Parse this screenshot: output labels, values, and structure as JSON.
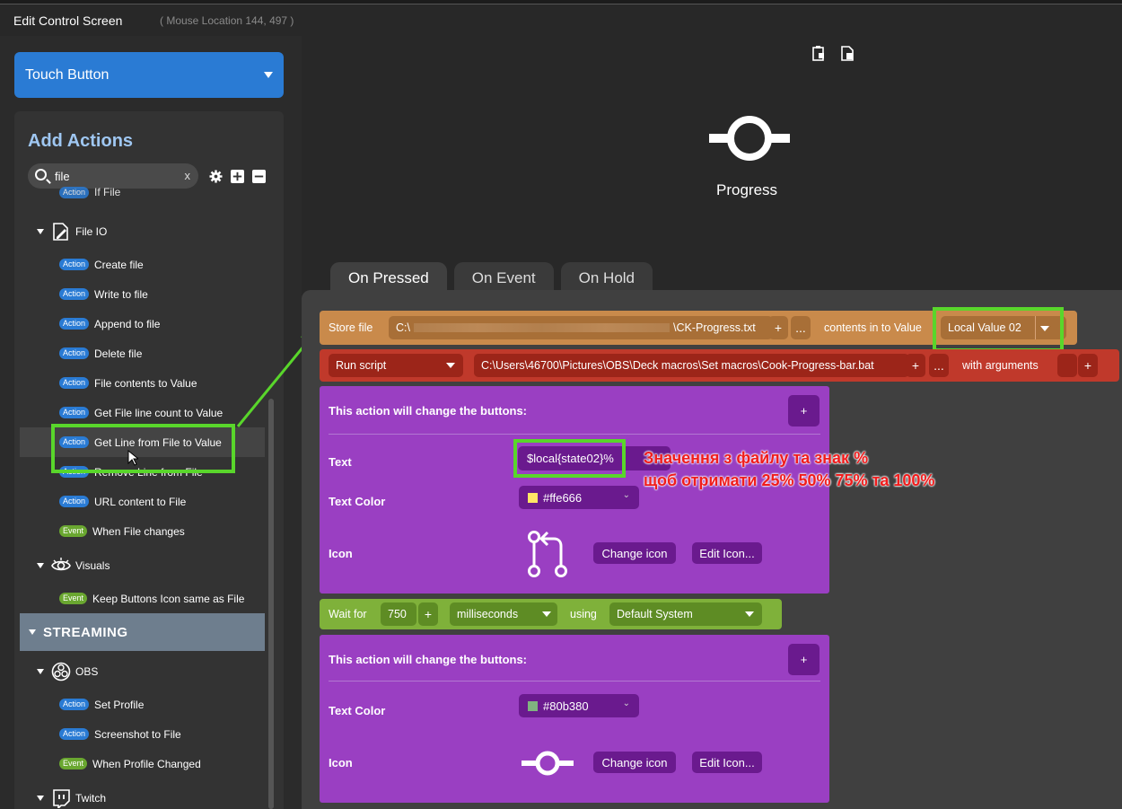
{
  "window": {
    "title": "Edit Control Screen",
    "mouse_location": "( Mouse Location 144, 497 )"
  },
  "control_type": {
    "selected": "Touch Button"
  },
  "add_actions": {
    "title": "Add Actions",
    "search_value": "file",
    "clear_label": "x",
    "items": [
      {
        "type": "row",
        "badge": "Action",
        "label": "If File",
        "kind": "action"
      },
      {
        "type": "group",
        "label": "File IO",
        "icon": "file-edit-icon"
      },
      {
        "type": "row",
        "badge": "Action",
        "label": "Create file",
        "kind": "action"
      },
      {
        "type": "row",
        "badge": "Action",
        "label": "Write to file",
        "kind": "action"
      },
      {
        "type": "row",
        "badge": "Action",
        "label": "Append to file",
        "kind": "action"
      },
      {
        "type": "row",
        "badge": "Action",
        "label": "Delete file",
        "kind": "action"
      },
      {
        "type": "row",
        "badge": "Action",
        "label": "File contents to Value",
        "kind": "action"
      },
      {
        "type": "row",
        "badge": "Action",
        "label": "Get File line count to Value",
        "kind": "action"
      },
      {
        "type": "row",
        "badge": "Action",
        "label": "Get Line from File to Value",
        "kind": "action",
        "highlighted": true
      },
      {
        "type": "row",
        "badge": "Action",
        "label": "Remove Line from File",
        "kind": "action"
      },
      {
        "type": "row",
        "badge": "Action",
        "label": "URL content to File",
        "kind": "action"
      },
      {
        "type": "row",
        "badge": "Event",
        "label": "When File changes",
        "kind": "event"
      },
      {
        "type": "group",
        "label": "Visuals",
        "icon": "eye-icon"
      },
      {
        "type": "row",
        "badge": "Event",
        "label": "Keep Buttons Icon same as File",
        "kind": "event"
      },
      {
        "type": "section",
        "label": "STREAMING"
      },
      {
        "type": "group",
        "label": "OBS",
        "icon": "obs-icon"
      },
      {
        "type": "row",
        "badge": "Action",
        "label": "Set Profile",
        "kind": "action"
      },
      {
        "type": "row",
        "badge": "Action",
        "label": "Screenshot to File",
        "kind": "action"
      },
      {
        "type": "row",
        "badge": "Event",
        "label": "When Profile Changed",
        "kind": "event"
      },
      {
        "type": "group",
        "label": "Twitch",
        "icon": "twitch-icon"
      }
    ]
  },
  "preview": {
    "label": "Progress"
  },
  "tabs": [
    "On Pressed",
    "On Event",
    "On Hold"
  ],
  "actions": {
    "store_file": {
      "label": "Store file",
      "path_start": "C:\\",
      "path_end": "\\CK-Progress.txt",
      "plus": "+",
      "more": "...",
      "middle": "contents in to Value",
      "value": "Local Value 02"
    },
    "run_script": {
      "mode": "Run script",
      "path": "C:\\Users\\46700\\Pictures\\OBS\\Deck macros\\Set macros\\Cook-Progress-bar.bat",
      "plus": "+",
      "more": "...",
      "with_args": "with arguments",
      "plus2": "+"
    },
    "change1": {
      "title": "This action will change the buttons:",
      "plus": "+",
      "text_label": "Text",
      "text_value": "$local{state02}%",
      "color_label": "Text Color",
      "color_value": "#ffe666",
      "color_swatch": "#ffe666",
      "icon_label": "Icon",
      "change_icon": "Change icon",
      "edit_icon": "Edit Icon..."
    },
    "wait": {
      "label": "Wait for",
      "value": "750",
      "plus": "+",
      "unit": "milliseconds",
      "using": "using",
      "system": "Default System"
    },
    "change2": {
      "title": "This action will change the buttons:",
      "plus": "+",
      "color_label": "Text Color",
      "color_value": "#80b380",
      "color_swatch": "#80b380",
      "icon_label": "Icon",
      "change_icon": "Change icon",
      "edit_icon": "Edit Icon..."
    }
  },
  "annotation": {
    "line1": "Значення з файлу та знак %",
    "line2": "щоб отримати 25% 50% 75% та 100%"
  },
  "colors": {
    "accent_blue": "#2a7bd4",
    "store_orange": "#c98a4b",
    "script_red": "#c0392b",
    "purple": "#9a3fc2",
    "wait_green": "#7fb13a",
    "highlight_green": "#59d62b",
    "annotation_red": "#f01c1c"
  }
}
